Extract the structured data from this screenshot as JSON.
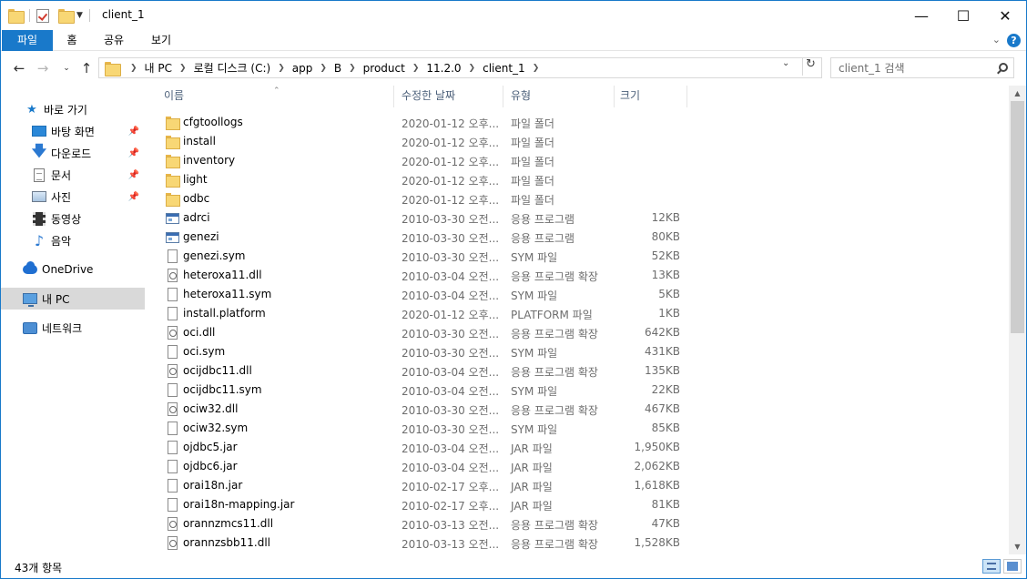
{
  "window": {
    "title": "client_1"
  },
  "ribbon": {
    "tabs": [
      "파일",
      "홈",
      "공유",
      "보기"
    ],
    "help": "?"
  },
  "address": {
    "crumbs": [
      "내 PC",
      "로컬 디스크 (C:)",
      "app",
      "B",
      "product",
      "11.2.0",
      "client_1"
    ]
  },
  "search": {
    "placeholder": "client_1 검색"
  },
  "navpane": {
    "quick_access": "바로 가기",
    "items": [
      "바탕 화면",
      "다운로드",
      "문서",
      "사진",
      "동영상",
      "음악"
    ],
    "onedrive": "OneDrive",
    "this_pc": "내 PC",
    "network": "네트워크"
  },
  "columns": {
    "name": "이름",
    "date": "수정한 날짜",
    "type": "유형",
    "size": "크기"
  },
  "files": [
    {
      "icon": "folder",
      "name": "cfgtoollogs",
      "date": "2020-01-12 오후...",
      "type": "파일 폴더",
      "size": ""
    },
    {
      "icon": "folder",
      "name": "install",
      "date": "2020-01-12 오후...",
      "type": "파일 폴더",
      "size": ""
    },
    {
      "icon": "folder",
      "name": "inventory",
      "date": "2020-01-12 오후...",
      "type": "파일 폴더",
      "size": ""
    },
    {
      "icon": "folder",
      "name": "light",
      "date": "2020-01-12 오후...",
      "type": "파일 폴더",
      "size": ""
    },
    {
      "icon": "folder",
      "name": "odbc",
      "date": "2020-01-12 오후...",
      "type": "파일 폴더",
      "size": ""
    },
    {
      "icon": "exe",
      "name": "adrci",
      "date": "2010-03-30 오전...",
      "type": "응용 프로그램",
      "size": "12KB"
    },
    {
      "icon": "exe",
      "name": "genezi",
      "date": "2010-03-30 오전...",
      "type": "응용 프로그램",
      "size": "80KB"
    },
    {
      "icon": "file",
      "name": "genezi.sym",
      "date": "2010-03-30 오전...",
      "type": "SYM 파일",
      "size": "52KB"
    },
    {
      "icon": "dll",
      "name": "heteroxa11.dll",
      "date": "2010-03-04 오전...",
      "type": "응용 프로그램 확장",
      "size": "13KB"
    },
    {
      "icon": "file",
      "name": "heteroxa11.sym",
      "date": "2010-03-04 오전...",
      "type": "SYM 파일",
      "size": "5KB"
    },
    {
      "icon": "file",
      "name": "install.platform",
      "date": "2020-01-12 오후...",
      "type": "PLATFORM 파일",
      "size": "1KB"
    },
    {
      "icon": "dll",
      "name": "oci.dll",
      "date": "2010-03-30 오전...",
      "type": "응용 프로그램 확장",
      "size": "642KB"
    },
    {
      "icon": "file",
      "name": "oci.sym",
      "date": "2010-03-30 오전...",
      "type": "SYM 파일",
      "size": "431KB"
    },
    {
      "icon": "dll",
      "name": "ocijdbc11.dll",
      "date": "2010-03-04 오전...",
      "type": "응용 프로그램 확장",
      "size": "135KB"
    },
    {
      "icon": "file",
      "name": "ocijdbc11.sym",
      "date": "2010-03-04 오전...",
      "type": "SYM 파일",
      "size": "22KB"
    },
    {
      "icon": "dll",
      "name": "ociw32.dll",
      "date": "2010-03-30 오전...",
      "type": "응용 프로그램 확장",
      "size": "467KB"
    },
    {
      "icon": "file",
      "name": "ociw32.sym",
      "date": "2010-03-30 오전...",
      "type": "SYM 파일",
      "size": "85KB"
    },
    {
      "icon": "file",
      "name": "ojdbc5.jar",
      "date": "2010-03-04 오전...",
      "type": "JAR 파일",
      "size": "1,950KB"
    },
    {
      "icon": "file",
      "name": "ojdbc6.jar",
      "date": "2010-03-04 오전...",
      "type": "JAR 파일",
      "size": "2,062KB"
    },
    {
      "icon": "file",
      "name": "orai18n.jar",
      "date": "2010-02-17 오후...",
      "type": "JAR 파일",
      "size": "1,618KB"
    },
    {
      "icon": "file",
      "name": "orai18n-mapping.jar",
      "date": "2010-02-17 오후...",
      "type": "JAR 파일",
      "size": "81KB"
    },
    {
      "icon": "dll",
      "name": "orannzmcs11.dll",
      "date": "2010-03-13 오전...",
      "type": "응용 프로그램 확장",
      "size": "47KB"
    },
    {
      "icon": "dll",
      "name": "orannzsbb11.dll",
      "date": "2010-03-13 오전...",
      "type": "응용 프로그램 확장",
      "size": "1,528KB"
    }
  ],
  "status": {
    "count": "43개 항목"
  },
  "colors": {
    "accent": "#1979ca",
    "folder": "#f8d775",
    "selected": "#d9d9d9"
  }
}
